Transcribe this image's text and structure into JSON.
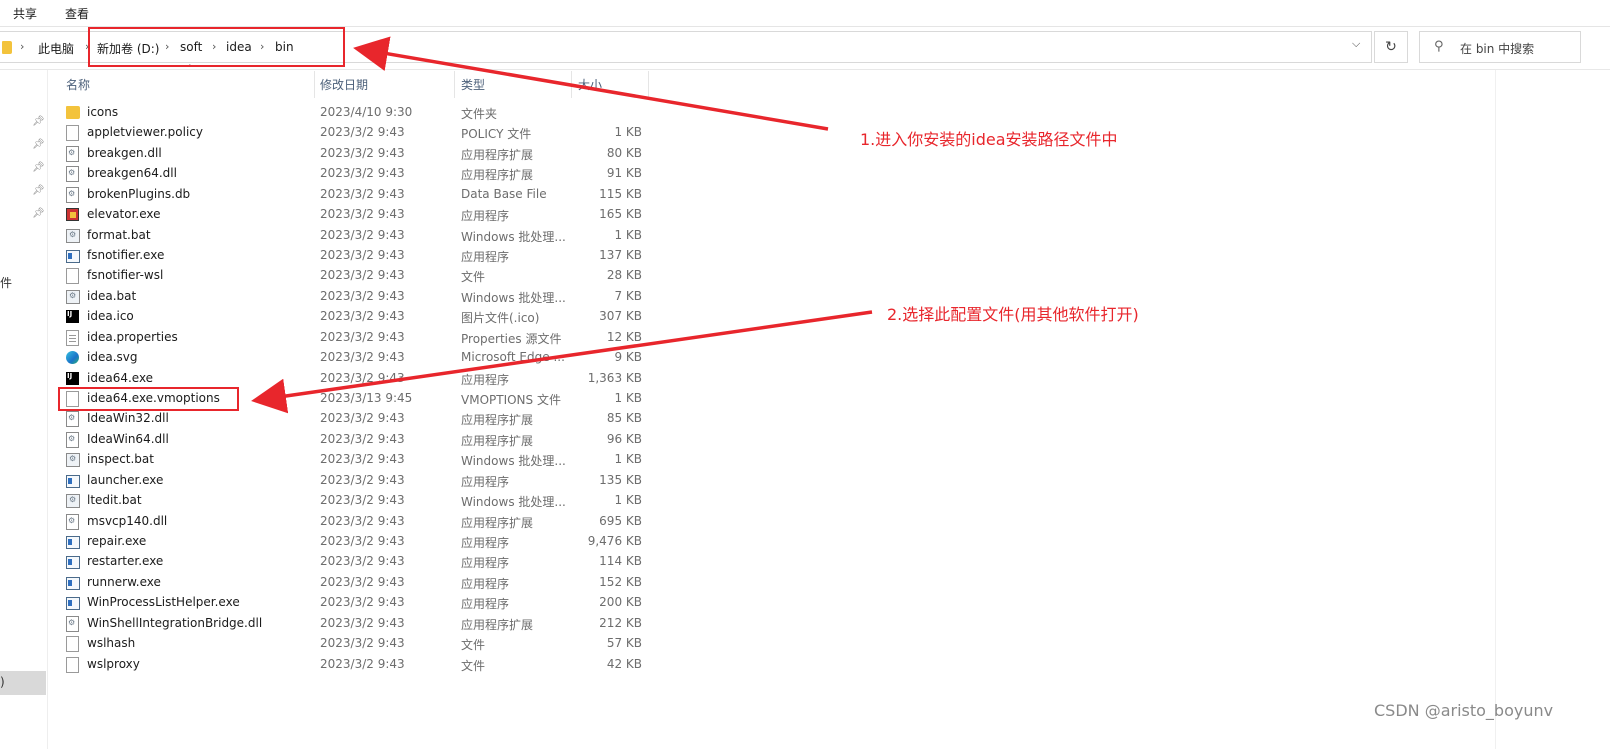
{
  "ribbon": {
    "tabs": [
      "共享",
      "查看"
    ]
  },
  "address": {
    "crumbs": [
      "此电脑",
      "新加卷 (D:)",
      "soft",
      "idea",
      "bin"
    ],
    "search_placeholder": "在 bin 中搜索"
  },
  "columns": {
    "name": "名称",
    "date": "修改日期",
    "type": "类型",
    "size": "大小"
  },
  "files": [
    {
      "name": "icons",
      "date": "2023/4/10 9:30",
      "type": "文件夹",
      "size": "",
      "icon": "folder-icon"
    },
    {
      "name": "appletviewer.policy",
      "date": "2023/3/2 9:43",
      "type": "POLICY 文件",
      "size": "1 KB",
      "icon": "file-icon"
    },
    {
      "name": "breakgen.dll",
      "date": "2023/3/2 9:43",
      "type": "应用程序扩展",
      "size": "80 KB",
      "icon": "dll-icon"
    },
    {
      "name": "breakgen64.dll",
      "date": "2023/3/2 9:43",
      "type": "应用程序扩展",
      "size": "91 KB",
      "icon": "dll-icon"
    },
    {
      "name": "brokenPlugins.db",
      "date": "2023/3/2 9:43",
      "type": "Data Base File",
      "size": "115 KB",
      "icon": "db-icon"
    },
    {
      "name": "elevator.exe",
      "date": "2023/3/2 9:43",
      "type": "应用程序",
      "size": "165 KB",
      "icon": "elevator-icon"
    },
    {
      "name": "format.bat",
      "date": "2023/3/2 9:43",
      "type": "Windows 批处理...",
      "size": "1 KB",
      "icon": "bat-icon"
    },
    {
      "name": "fsnotifier.exe",
      "date": "2023/3/2 9:43",
      "type": "应用程序",
      "size": "137 KB",
      "icon": "exe-icon"
    },
    {
      "name": "fsnotifier-wsl",
      "date": "2023/3/2 9:43",
      "type": "文件",
      "size": "28 KB",
      "icon": "file-icon"
    },
    {
      "name": "idea.bat",
      "date": "2023/3/2 9:43",
      "type": "Windows 批处理...",
      "size": "7 KB",
      "icon": "bat-icon"
    },
    {
      "name": "idea.ico",
      "date": "2023/3/2 9:43",
      "type": "图片文件(.ico)",
      "size": "307 KB",
      "icon": "idea-icon"
    },
    {
      "name": "idea.properties",
      "date": "2023/3/2 9:43",
      "type": "Properties 源文件",
      "size": "12 KB",
      "icon": "properties-icon"
    },
    {
      "name": "idea.svg",
      "date": "2023/3/2 9:43",
      "type": "Microsoft Edge ...",
      "size": "9 KB",
      "icon": "edge-icon"
    },
    {
      "name": "idea64.exe",
      "date": "2023/3/2 9:43",
      "type": "应用程序",
      "size": "1,363 KB",
      "icon": "idea-icon"
    },
    {
      "name": "idea64.exe.vmoptions",
      "date": "2023/3/13 9:45",
      "type": "VMOPTIONS 文件",
      "size": "1 KB",
      "icon": "file-icon"
    },
    {
      "name": "IdeaWin32.dll",
      "date": "2023/3/2 9:43",
      "type": "应用程序扩展",
      "size": "85 KB",
      "icon": "dll-icon"
    },
    {
      "name": "IdeaWin64.dll",
      "date": "2023/3/2 9:43",
      "type": "应用程序扩展",
      "size": "96 KB",
      "icon": "dll-icon"
    },
    {
      "name": "inspect.bat",
      "date": "2023/3/2 9:43",
      "type": "Windows 批处理...",
      "size": "1 KB",
      "icon": "bat-icon"
    },
    {
      "name": "launcher.exe",
      "date": "2023/3/2 9:43",
      "type": "应用程序",
      "size": "135 KB",
      "icon": "exe-icon"
    },
    {
      "name": "ltedit.bat",
      "date": "2023/3/2 9:43",
      "type": "Windows 批处理...",
      "size": "1 KB",
      "icon": "bat-icon"
    },
    {
      "name": "msvcp140.dll",
      "date": "2023/3/2 9:43",
      "type": "应用程序扩展",
      "size": "695 KB",
      "icon": "dll-icon"
    },
    {
      "name": "repair.exe",
      "date": "2023/3/2 9:43",
      "type": "应用程序",
      "size": "9,476 KB",
      "icon": "exe-icon"
    },
    {
      "name": "restarter.exe",
      "date": "2023/3/2 9:43",
      "type": "应用程序",
      "size": "114 KB",
      "icon": "exe-icon"
    },
    {
      "name": "runnerw.exe",
      "date": "2023/3/2 9:43",
      "type": "应用程序",
      "size": "152 KB",
      "icon": "exe-icon"
    },
    {
      "name": "WinProcessListHelper.exe",
      "date": "2023/3/2 9:43",
      "type": "应用程序",
      "size": "200 KB",
      "icon": "exe-icon"
    },
    {
      "name": "WinShellIntegrationBridge.dll",
      "date": "2023/3/2 9:43",
      "type": "应用程序扩展",
      "size": "212 KB",
      "icon": "dll-icon"
    },
    {
      "name": "wslhash",
      "date": "2023/3/2 9:43",
      "type": "文件",
      "size": "57 KB",
      "icon": "file-icon"
    },
    {
      "name": "wslproxy",
      "date": "2023/3/2 9:43",
      "type": "文件",
      "size": "42 KB",
      "icon": "file-icon"
    }
  ],
  "nav_fragments": {
    "left_char": "件",
    "selected_char": ")"
  },
  "annotations": {
    "note1": "1.进入你安装的idea安装路径文件中",
    "note2": "2.选择此配置文件(用其他软件打开)",
    "color": "#e8262c"
  },
  "watermark": "CSDN @aristo_boyunv"
}
